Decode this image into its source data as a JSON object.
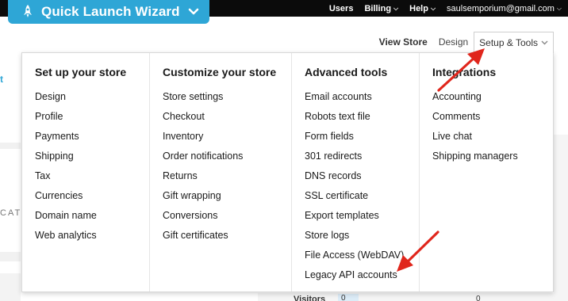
{
  "wizard": {
    "label": "Quick Launch Wizard"
  },
  "topnav": {
    "users": "Users",
    "billing": "Billing",
    "help": "Help",
    "email": "saulsemporium@gmail.com"
  },
  "subnav": {
    "view_store": "View Store",
    "design": "Design",
    "setup_tools": "Setup & Tools"
  },
  "background": {
    "partial_t": "t",
    "partial_cat": "CAT",
    "visitors_label": "Visitors",
    "visitors_value_1": "0",
    "visitors_value_2": "0"
  },
  "menu": {
    "columns": [
      {
        "heading": "Set up your store",
        "items": [
          "Design",
          "Profile",
          "Payments",
          "Shipping",
          "Tax",
          "Currencies",
          "Domain name",
          "Web analytics"
        ]
      },
      {
        "heading": "Customize your store",
        "items": [
          "Store settings",
          "Checkout",
          "Inventory",
          "Order notifications",
          "Returns",
          "Gift wrapping",
          "Conversions",
          "Gift certificates"
        ]
      },
      {
        "heading": "Advanced tools",
        "items": [
          "Email accounts",
          "Robots text file",
          "Form fields",
          "301 redirects",
          "DNS records",
          "SSL certificate",
          "Export templates",
          "Store logs",
          "File Access (WebDAV)",
          "Legacy API accounts"
        ]
      },
      {
        "heading": "Integrations",
        "items": [
          "Accounting",
          "Comments",
          "Live chat",
          "Shipping managers"
        ]
      }
    ]
  },
  "colors": {
    "wizard_blue": "#2ea6d6",
    "topbar": "#0b0b0b",
    "arrow_red": "#e0261c"
  }
}
